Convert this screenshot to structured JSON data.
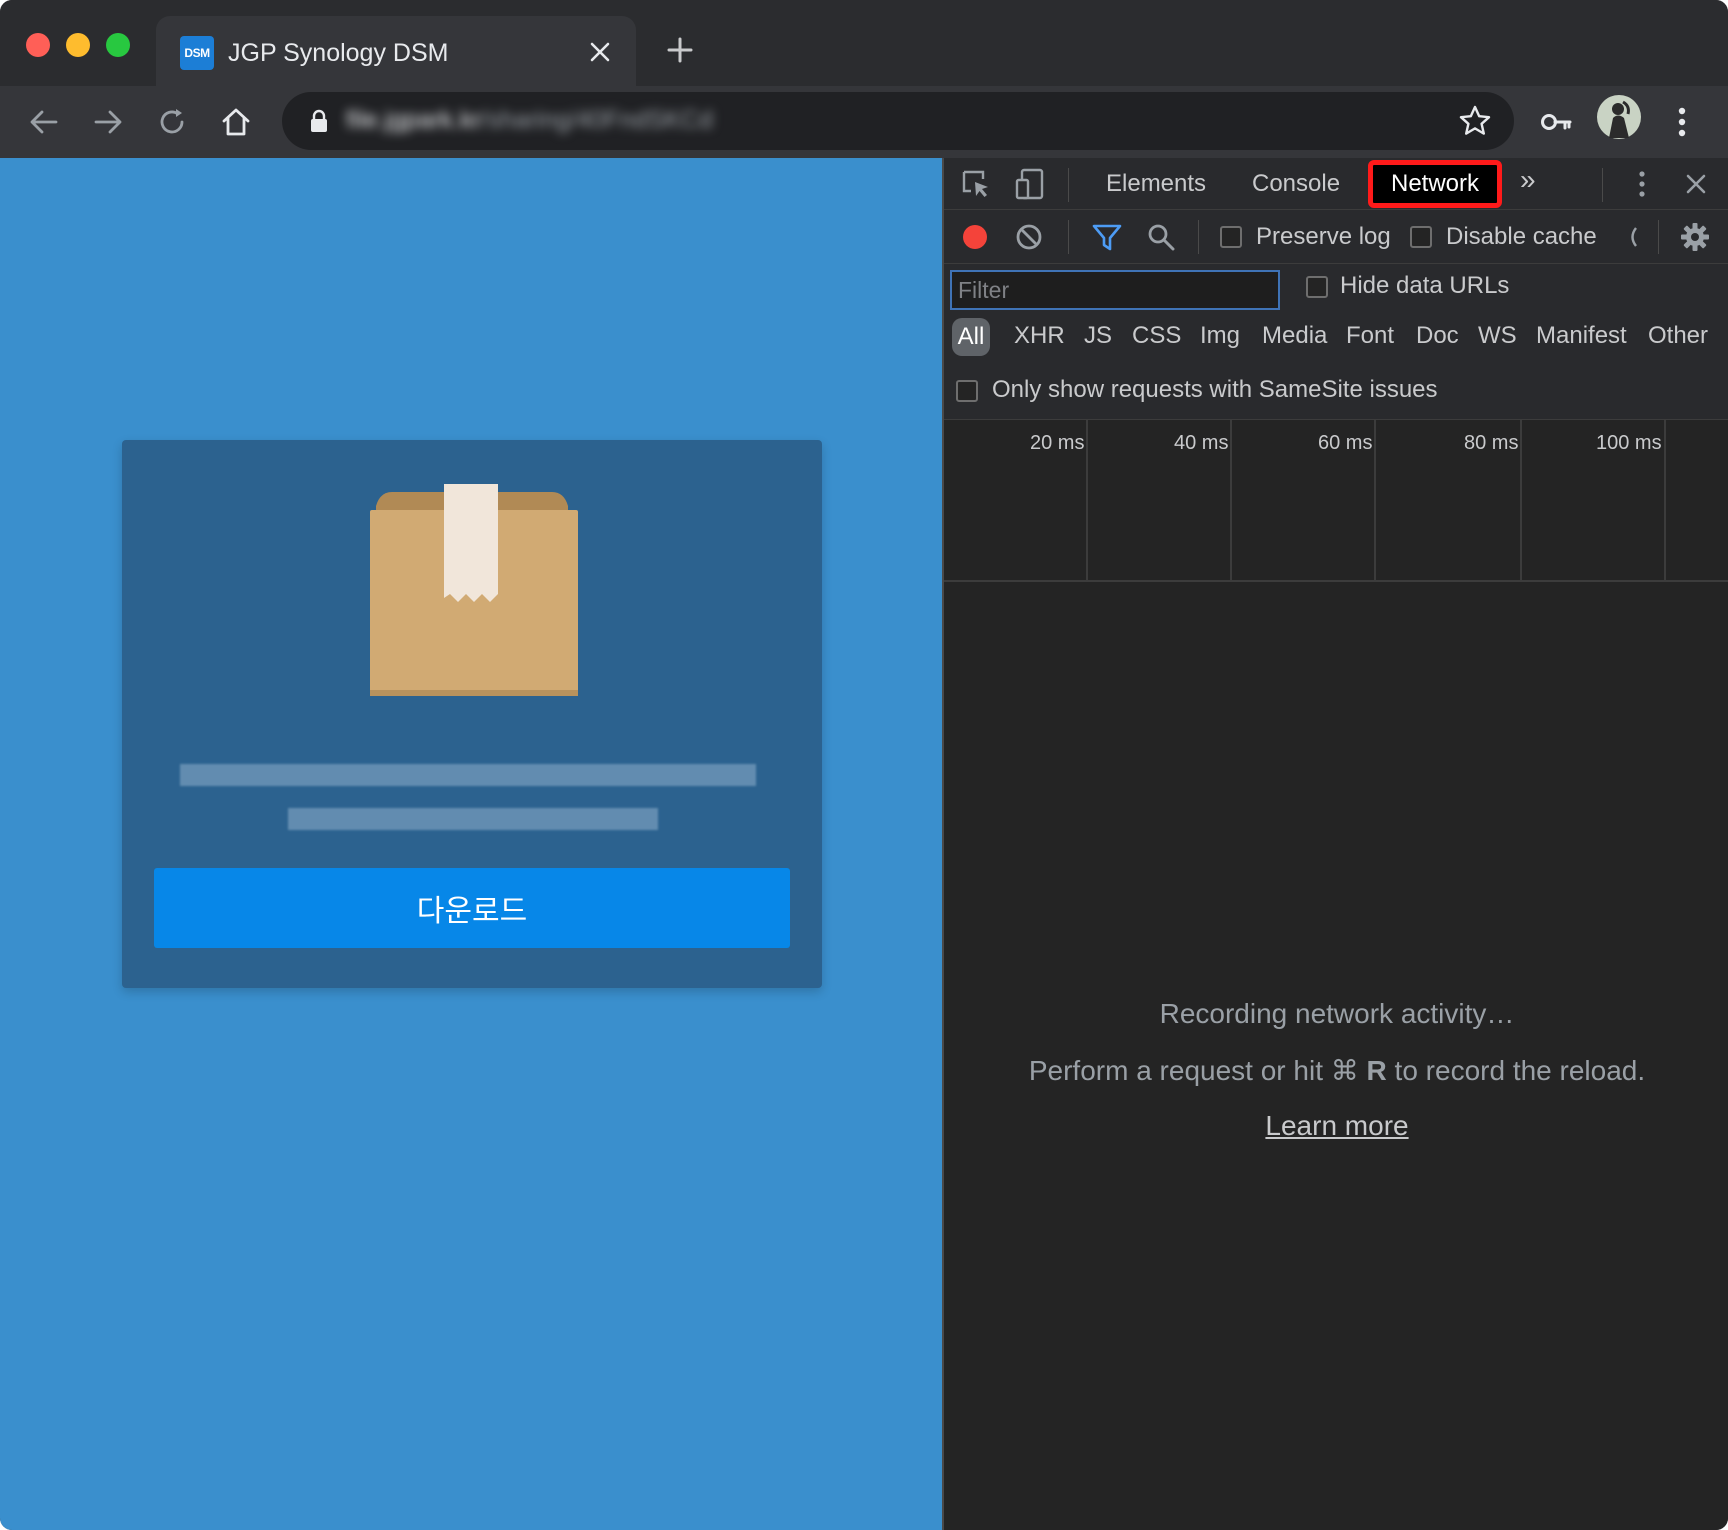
{
  "browser": {
    "tab": {
      "favicon_text": "DSM",
      "title": "JGP Synology DSM"
    },
    "address_bar": {
      "url_host": "file.jgpark.kr",
      "url_path": "/sharing/40FndSKCd",
      "url_blurred": true
    }
  },
  "page": {
    "background_color": "#3a8fcd",
    "card_color": "#2c628f",
    "download_button_label": "다운로드",
    "download_button_color": "#0787e8",
    "box_icon": "package-box-icon"
  },
  "devtools": {
    "tabs": [
      "Elements",
      "Console",
      "Network"
    ],
    "active_tab": "Network",
    "active_tab_highlight_color": "#ff1a1a",
    "more_tabs_glyph": "»",
    "toolbar": {
      "preserve_log_label": "Preserve log",
      "preserve_log_checked": false,
      "disable_cache_label": "Disable cache",
      "disable_cache_checked": false,
      "recording": true,
      "record_color": "#f4433a"
    },
    "filter": {
      "placeholder": "Filter",
      "value": "",
      "hide_data_urls_label": "Hide data URLs",
      "hide_data_urls_checked": false,
      "types": [
        "All",
        "XHR",
        "JS",
        "CSS",
        "Img",
        "Media",
        "Font",
        "Doc",
        "WS",
        "Manifest",
        "Other"
      ],
      "active_type": "All",
      "samesite_label": "Only show requests with SameSite issues",
      "samesite_checked": false
    },
    "timeline": {
      "ticks": [
        "20 ms",
        "40 ms",
        "60 ms",
        "80 ms",
        "100 ms"
      ]
    },
    "empty_state": {
      "line1": "Recording network activity…",
      "line2_prefix": "Perform a request or hit ",
      "line2_key_cmd": "⌘",
      "line2_key_r": "R",
      "line2_suffix": " to record the reload.",
      "link": "Learn more"
    }
  }
}
